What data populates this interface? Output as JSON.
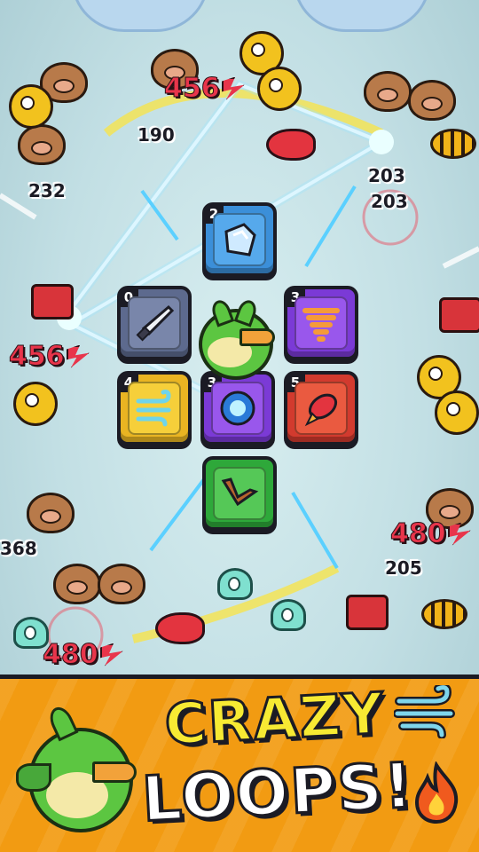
{
  "promo": {
    "headline_line1": "CRAZY",
    "headline_line2": "LOOPS!"
  },
  "board": {
    "skill_tiles": [
      {
        "id": "ice-block",
        "level": "2",
        "color": "#3b8fd9",
        "icon": "ice-cube-icon"
      },
      {
        "id": "dagger",
        "level": "0",
        "color": "#5d6a8e",
        "icon": "dagger-icon"
      },
      {
        "id": "tornado",
        "level": "3",
        "color": "#7b3ad6",
        "icon": "tornado-icon"
      },
      {
        "id": "wind",
        "level": "4",
        "color": "#e9b422",
        "icon": "wind-icon"
      },
      {
        "id": "vortex",
        "level": "3",
        "color": "#7b3ad6",
        "icon": "vortex-icon"
      },
      {
        "id": "rocket",
        "level": "5",
        "color": "#d23a2e",
        "icon": "rocket-icon"
      },
      {
        "id": "boomerang",
        "level": "",
        "color": "#2ea83a",
        "icon": "boomerang-icon"
      }
    ]
  },
  "damage_numbers": {
    "crit_top": "456",
    "crit_left": "456",
    "crit_bottom_right": "480",
    "crit_bottom_left": "480",
    "n190": "190",
    "n232": "232",
    "n203a": "203",
    "n203b": "203",
    "n368": "368",
    "n205": "205"
  },
  "colors": {
    "banner": "#f29b12",
    "headline_yellow": "#f7ea33",
    "crit_red": "#e8354b",
    "lightning": "#f6fbff"
  }
}
